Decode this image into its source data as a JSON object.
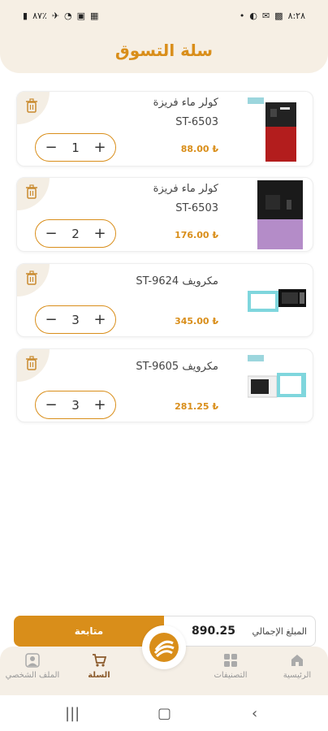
{
  "status_bar": {
    "time": "٨:٢٨",
    "battery": "٨٧٪",
    "left_icons": [
      "battery-icon",
      "airplane-icon",
      "wifi-icon",
      "sim-icon",
      "calendar-icon"
    ],
    "right_icons": [
      "gallery-icon",
      "gmail-icon",
      "theme-icon",
      "dot-icon"
    ]
  },
  "header": {
    "title": "سلة التسوق"
  },
  "cart": {
    "items": [
      {
        "name": "كولر ماء فريزة",
        "model": "ST-6503",
        "price": "88.00 ₺",
        "qty": "1",
        "image": "red-water-cooler"
      },
      {
        "name": "كولر ماء فريزة",
        "model": "ST-6503",
        "price": "176.00 ₺",
        "qty": "2",
        "image": "purple-water-cooler"
      },
      {
        "name": "مكرويف ST-9624",
        "price": "345.00 ₺",
        "qty": "3",
        "image": "microwave-black"
      },
      {
        "name": "مكرويف ST-9605",
        "price": "281.25 ₺",
        "qty": "3",
        "image": "microwave-white"
      }
    ]
  },
  "footer": {
    "continue_label": "متابعة",
    "total_label": "المبلغ الإجمالي",
    "total_value": "890.25"
  },
  "nav": {
    "home": "الرئيسية",
    "categories": "التصنيفات",
    "cart": "السلة",
    "profile": "الملف الشخصي"
  },
  "colors": {
    "accent": "#d98e1a",
    "header_bg": "#f6efe4",
    "nav_bg": "#f5efe6"
  }
}
